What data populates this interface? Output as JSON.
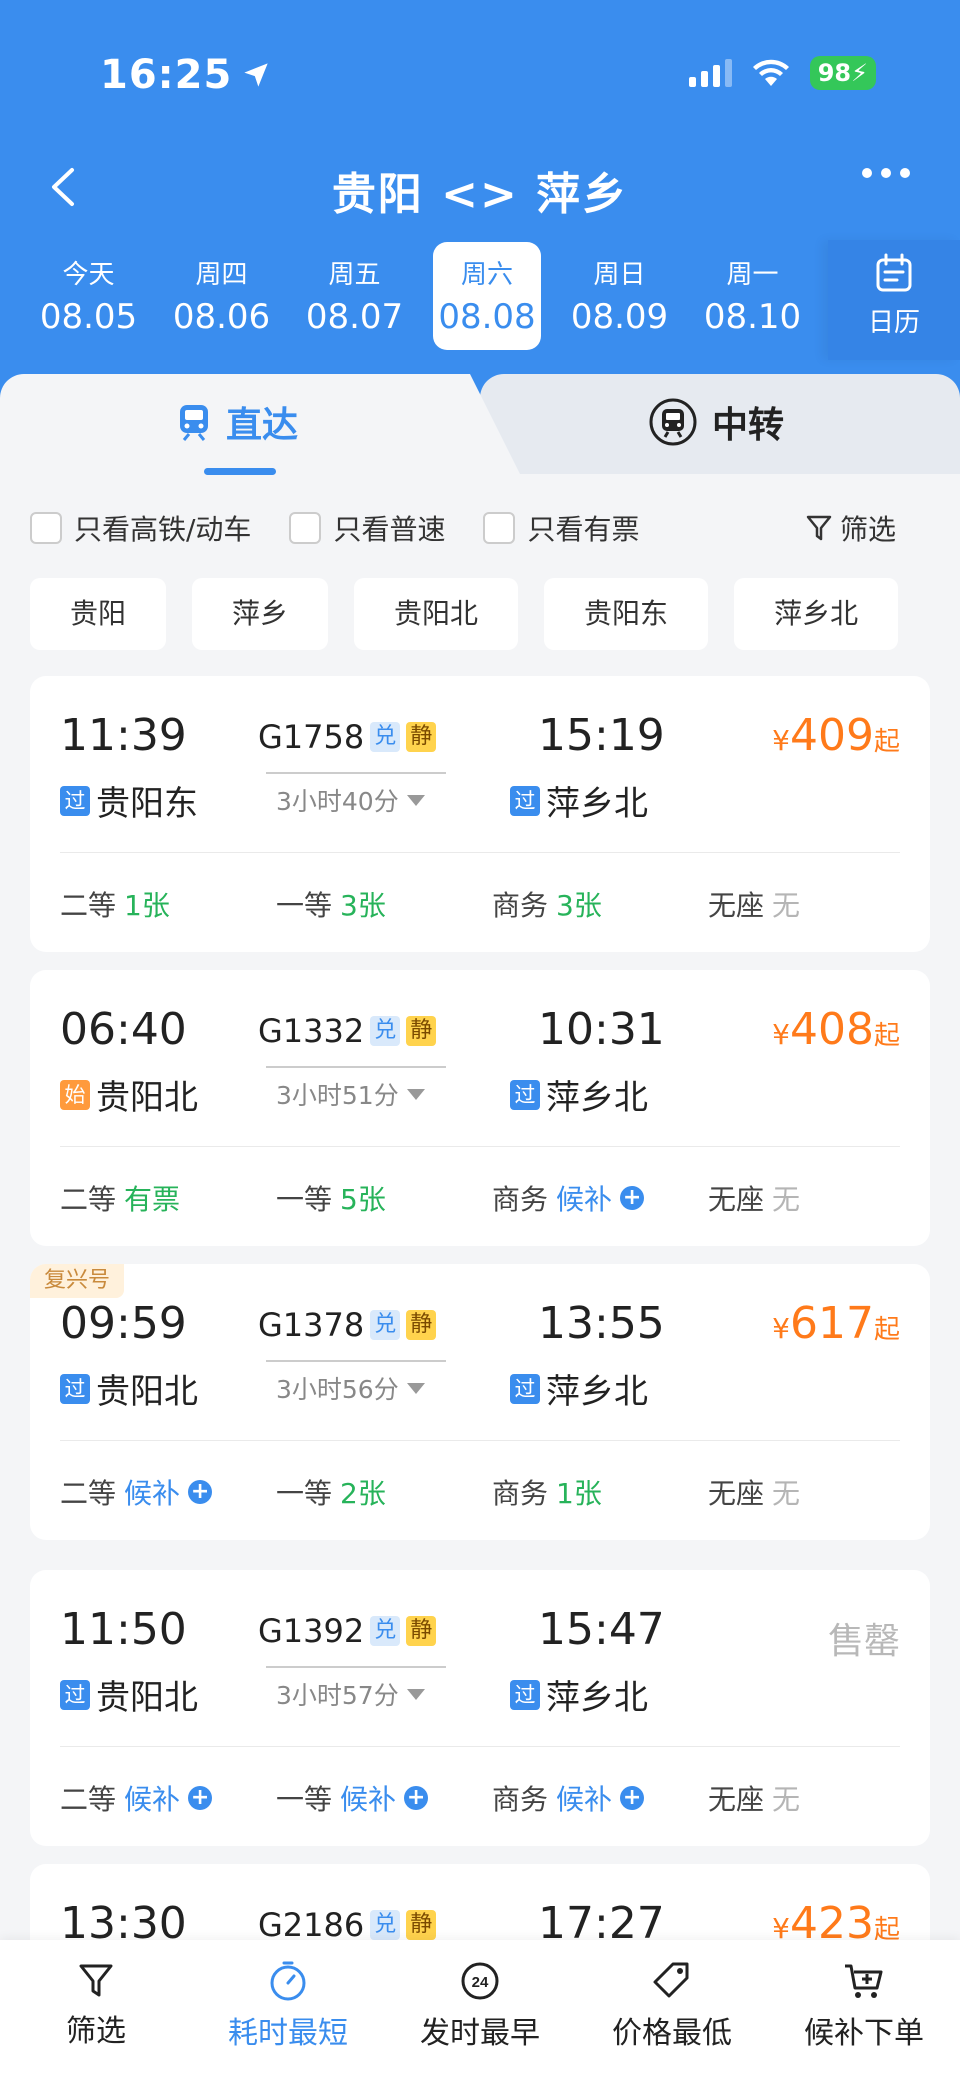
{
  "status_bar": {
    "time": "16:25",
    "battery": "98"
  },
  "nav": {
    "title": "贵阳 <> 萍乡"
  },
  "dates": [
    {
      "weekday": "今天",
      "date": "08.05"
    },
    {
      "weekday": "周四",
      "date": "08.06"
    },
    {
      "weekday": "周五",
      "date": "08.07"
    },
    {
      "weekday": "周六",
      "date": "08.08"
    },
    {
      "weekday": "周日",
      "date": "08.09"
    },
    {
      "weekday": "周一",
      "date": "08.10"
    }
  ],
  "calendar_label": "日历",
  "tabs": {
    "direct": "直达",
    "transfer": "中转"
  },
  "filters": {
    "high_speed": "只看高铁/动车",
    "normal": "只看普速",
    "available": "只看有票",
    "filter": "筛选"
  },
  "stations": [
    "贵阳",
    "萍乡",
    "贵阳北",
    "贵阳东",
    "萍乡北"
  ],
  "trains": [
    {
      "dep_time": "11:39",
      "train_no": "G1758",
      "tag1": "兑",
      "tag2": "静",
      "arr_time": "15:19",
      "duration": "3小时40分",
      "from_badge": "过",
      "from": "贵阳东",
      "to_badge": "过",
      "to": "萍乡北",
      "price_symbol": "¥",
      "price": "409",
      "price_suffix": "起",
      "seats": [
        {
          "name": "二等",
          "value": "1张"
        },
        {
          "name": "一等",
          "value": "3张"
        },
        {
          "name": "商务",
          "value": "3张"
        },
        {
          "name": "无座",
          "value": "无"
        }
      ]
    },
    {
      "dep_time": "06:40",
      "train_no": "G1332",
      "tag1": "兑",
      "tag2": "静",
      "arr_time": "10:31",
      "duration": "3小时51分",
      "from_badge": "始",
      "from": "贵阳北",
      "to_badge": "过",
      "to": "萍乡北",
      "price_symbol": "¥",
      "price": "408",
      "price_suffix": "起",
      "seats": [
        {
          "name": "二等",
          "value": "有票"
        },
        {
          "name": "一等",
          "value": "5张"
        },
        {
          "name": "商务",
          "value": "候补"
        },
        {
          "name": "无座",
          "value": "无"
        }
      ]
    },
    {
      "label": "复兴号",
      "dep_time": "09:59",
      "train_no": "G1378",
      "tag1": "兑",
      "tag2": "静",
      "arr_time": "13:55",
      "duration": "3小时56分",
      "from_badge": "过",
      "from": "贵阳北",
      "to_badge": "过",
      "to": "萍乡北",
      "price_symbol": "¥",
      "price": "617",
      "price_suffix": "起",
      "seats": [
        {
          "name": "二等",
          "value": "候补"
        },
        {
          "name": "一等",
          "value": "2张"
        },
        {
          "name": "商务",
          "value": "1张"
        },
        {
          "name": "无座",
          "value": "无"
        }
      ]
    },
    {
      "dep_time": "11:50",
      "train_no": "G1392",
      "tag1": "兑",
      "tag2": "静",
      "arr_time": "15:47",
      "duration": "3小时57分",
      "from_badge": "过",
      "from": "贵阳北",
      "to_badge": "过",
      "to": "萍乡北",
      "sold_out": "售罄",
      "seats": [
        {
          "name": "二等",
          "value": "候补"
        },
        {
          "name": "一等",
          "value": "候补"
        },
        {
          "name": "商务",
          "value": "候补"
        },
        {
          "name": "无座",
          "value": "无"
        }
      ]
    },
    {
      "dep_time": "13:30",
      "train_no": "G2186",
      "tag1": "兑",
      "tag2": "静",
      "arr_time": "17:27",
      "price_symbol": "¥",
      "price": "423",
      "price_suffix": "起"
    }
  ],
  "bottom_bar": [
    {
      "label": "筛选"
    },
    {
      "label": "耗时最短"
    },
    {
      "label": "发时最早"
    },
    {
      "label": "价格最低"
    },
    {
      "label": "候补下单"
    }
  ],
  "early_icon_text": "24",
  "colors": {
    "primary": "#3a8dee",
    "price": "#ff7a1a",
    "available": "#27b35a",
    "waitlist": "#3a8dee",
    "none": "#b5b5b5"
  }
}
